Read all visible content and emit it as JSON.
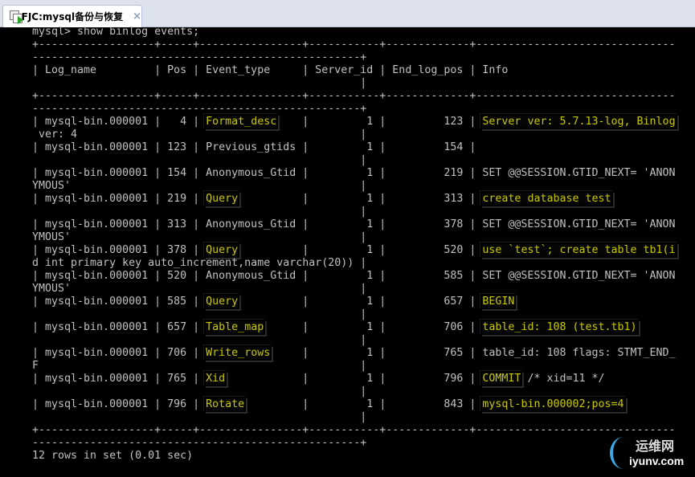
{
  "window": {
    "tab_title": "FJC:mysql备份与恢复",
    "close_symbol": "×"
  },
  "terminal": {
    "command": "mysql> show binlog events;",
    "headers": [
      "Log_name",
      "Pos",
      "Event_type",
      "Server_id",
      "End_log_pos",
      "Info"
    ],
    "rows": [
      {
        "log_name": "mysql-bin.000001",
        "pos": "4",
        "event_type": "Format_desc",
        "server_id": "1",
        "end_log_pos": "123",
        "info": "Server ver: 5.7.13-log, Binlog ver: 4",
        "hl_type": true,
        "hl_info": "Server ver: 5.7.13-log, Binlog"
      },
      {
        "log_name": "mysql-bin.000001",
        "pos": "123",
        "event_type": "Previous_gtids",
        "server_id": "1",
        "end_log_pos": "154",
        "info": "",
        "hl_type": false,
        "hl_info": ""
      },
      {
        "log_name": "mysql-bin.000001",
        "pos": "154",
        "event_type": "Anonymous_Gtid",
        "server_id": "1",
        "end_log_pos": "219",
        "info": "SET @@SESSION.GTID_NEXT= 'ANONYMOUS'",
        "hl_type": false,
        "hl_info": ""
      },
      {
        "log_name": "mysql-bin.000001",
        "pos": "219",
        "event_type": "Query",
        "server_id": "1",
        "end_log_pos": "313",
        "info": "create database test",
        "hl_type": true,
        "hl_info": "create database test"
      },
      {
        "log_name": "mysql-bin.000001",
        "pos": "313",
        "event_type": "Anonymous_Gtid",
        "server_id": "1",
        "end_log_pos": "378",
        "info": "SET @@SESSION.GTID_NEXT= 'ANONYMOUS'",
        "hl_type": false,
        "hl_info": ""
      },
      {
        "log_name": "mysql-bin.000001",
        "pos": "378",
        "event_type": "Query",
        "server_id": "1",
        "end_log_pos": "520",
        "info": "use `test`; create table tb1(id int primary key auto_increment,name varchar(20))",
        "hl_type": true,
        "hl_info": "use `test`; create table tb1(i"
      },
      {
        "log_name": "mysql-bin.000001",
        "pos": "520",
        "event_type": "Anonymous_Gtid",
        "server_id": "1",
        "end_log_pos": "585",
        "info": "SET @@SESSION.GTID_NEXT= 'ANONYMOUS'",
        "hl_type": false,
        "hl_info": ""
      },
      {
        "log_name": "mysql-bin.000001",
        "pos": "585",
        "event_type": "Query",
        "server_id": "1",
        "end_log_pos": "657",
        "info": "BEGIN",
        "hl_type": true,
        "hl_info": "BEGIN"
      },
      {
        "log_name": "mysql-bin.000001",
        "pos": "657",
        "event_type": "Table_map",
        "server_id": "1",
        "end_log_pos": "706",
        "info": "table_id: 108 (test.tb1)",
        "hl_type": true,
        "hl_info": "table_id: 108 (test.tb1)"
      },
      {
        "log_name": "mysql-bin.000001",
        "pos": "706",
        "event_type": "Write_rows",
        "server_id": "1",
        "end_log_pos": "765",
        "info": "table_id: 108 flags: STMT_END_F",
        "hl_type": true,
        "hl_info": ""
      },
      {
        "log_name": "mysql-bin.000001",
        "pos": "765",
        "event_type": "Xid",
        "server_id": "1",
        "end_log_pos": "796",
        "info": "COMMIT /* xid=11 */",
        "hl_type": true,
        "hl_info": "COMMIT"
      },
      {
        "log_name": "mysql-bin.000001",
        "pos": "796",
        "event_type": "Rotate",
        "server_id": "1",
        "end_log_pos": "843",
        "info": "mysql-bin.000002;pos=4",
        "hl_type": true,
        "hl_info": "mysql-bin.000002;pos=4"
      }
    ],
    "footer": "12 rows in set (0.01 sec)",
    "colors": {
      "text": "#c0c0c0",
      "highlight": "#c8c800",
      "background": "#000000"
    }
  },
  "watermark": {
    "cn": "运维网",
    "en": "iyunv.com"
  }
}
